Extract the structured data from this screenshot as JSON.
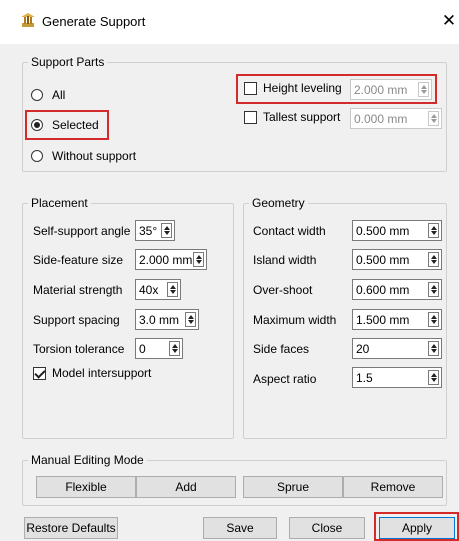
{
  "window": {
    "title": "Generate Support",
    "close_glyph": "✕"
  },
  "support_parts": {
    "legend": "Support Parts",
    "all_label": "All",
    "selected_label": "Selected",
    "without_label": "Without support",
    "selected_option": "Selected",
    "height_leveling_label": "Height leveling",
    "height_leveling_value": "2.000 mm",
    "tallest_support_label": "Tallest support",
    "tallest_support_value": "0.000 mm"
  },
  "placement": {
    "legend": "Placement",
    "self_support_angle_label": "Self-support angle",
    "self_support_angle_value": "35°",
    "side_feature_size_label": "Side-feature size",
    "side_feature_size_value": "2.000 mm",
    "material_strength_label": "Material strength",
    "material_strength_value": "40x",
    "support_spacing_label": "Support spacing",
    "support_spacing_value": "3.0 mm",
    "torsion_tolerance_label": "Torsion tolerance",
    "torsion_tolerance_value": "0",
    "model_intersupport_label": "Model intersupport"
  },
  "geometry": {
    "legend": "Geometry",
    "contact_width_label": "Contact width",
    "contact_width_value": "0.500 mm",
    "island_width_label": "Island width",
    "island_width_value": "0.500 mm",
    "over_shoot_label": "Over-shoot",
    "over_shoot_value": "0.600 mm",
    "maximum_width_label": "Maximum width",
    "maximum_width_value": "1.500 mm",
    "side_faces_label": "Side faces",
    "side_faces_value": "20",
    "aspect_ratio_label": "Aspect ratio",
    "aspect_ratio_value": "1.5"
  },
  "manual_editing": {
    "legend": "Manual Editing Mode",
    "flexible_label": "Flexible",
    "add_label": "Add",
    "sprue_label": "Sprue",
    "remove_label": "Remove"
  },
  "footer": {
    "restore_label": "Restore Defaults",
    "save_label": "Save",
    "close_label": "Close",
    "apply_label": "Apply"
  },
  "colors": {
    "highlight": "#d42a2a",
    "panel_bg": "#f0f0f0"
  }
}
